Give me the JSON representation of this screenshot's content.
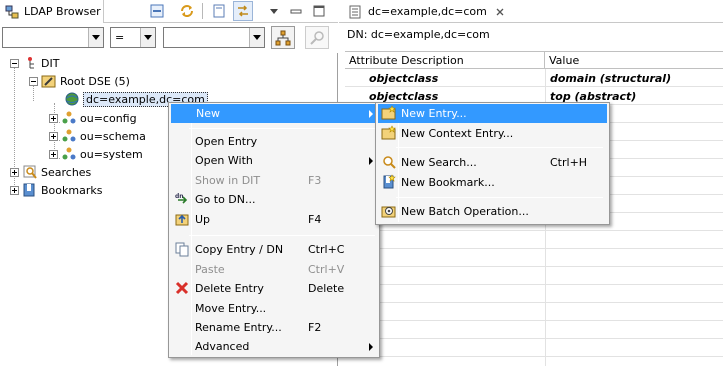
{
  "left_view": {
    "tab_title": "LDAP Browser",
    "filter": {
      "attr_value": "",
      "operator_value": "=",
      "value_value": ""
    },
    "tree": {
      "dit": "DIT",
      "root_dse": "Root DSE (5)",
      "selected": "dc=example,dc=com",
      "children": [
        "ou=config",
        "ou=schema",
        "ou=system"
      ],
      "searches": "Searches",
      "bookmarks": "Bookmarks"
    }
  },
  "editor": {
    "tab_title": "dc=example,dc=com",
    "dn_line": "DN: dc=example,dc=com",
    "columns": [
      "Attribute Description",
      "Value"
    ],
    "rows": [
      {
        "attribute": "objectclass",
        "value": "domain (structural)"
      },
      {
        "attribute": "objectclass",
        "value": "top (abstract)"
      }
    ]
  },
  "context_menu": {
    "new": "New",
    "open_entry": "Open Entry",
    "open_with": "Open With",
    "show_in_dit": "Show in DIT",
    "show_in_dit_shortcut": "F3",
    "go_to_dn": "Go to DN...",
    "up": "Up",
    "up_shortcut": "F4",
    "copy_entry_dn": "Copy Entry / DN",
    "copy_shortcut": "Ctrl+C",
    "paste": "Paste",
    "paste_shortcut": "Ctrl+V",
    "delete_entry": "Delete Entry",
    "delete_shortcut": "Delete",
    "move_entry": "Move Entry...",
    "rename_entry": "Rename Entry...",
    "rename_shortcut": "F2",
    "advanced": "Advanced"
  },
  "new_submenu": {
    "new_entry": "New Entry...",
    "new_context_entry": "New Context Entry...",
    "new_search": "New Search...",
    "new_search_shortcut": "Ctrl+H",
    "new_bookmark": "New Bookmark...",
    "new_batch_operation": "New Batch Operation..."
  },
  "colors": {
    "highlight": "#3399ff",
    "menu_bg": "#f5f5f5",
    "delete_icon": "#d9302a"
  }
}
